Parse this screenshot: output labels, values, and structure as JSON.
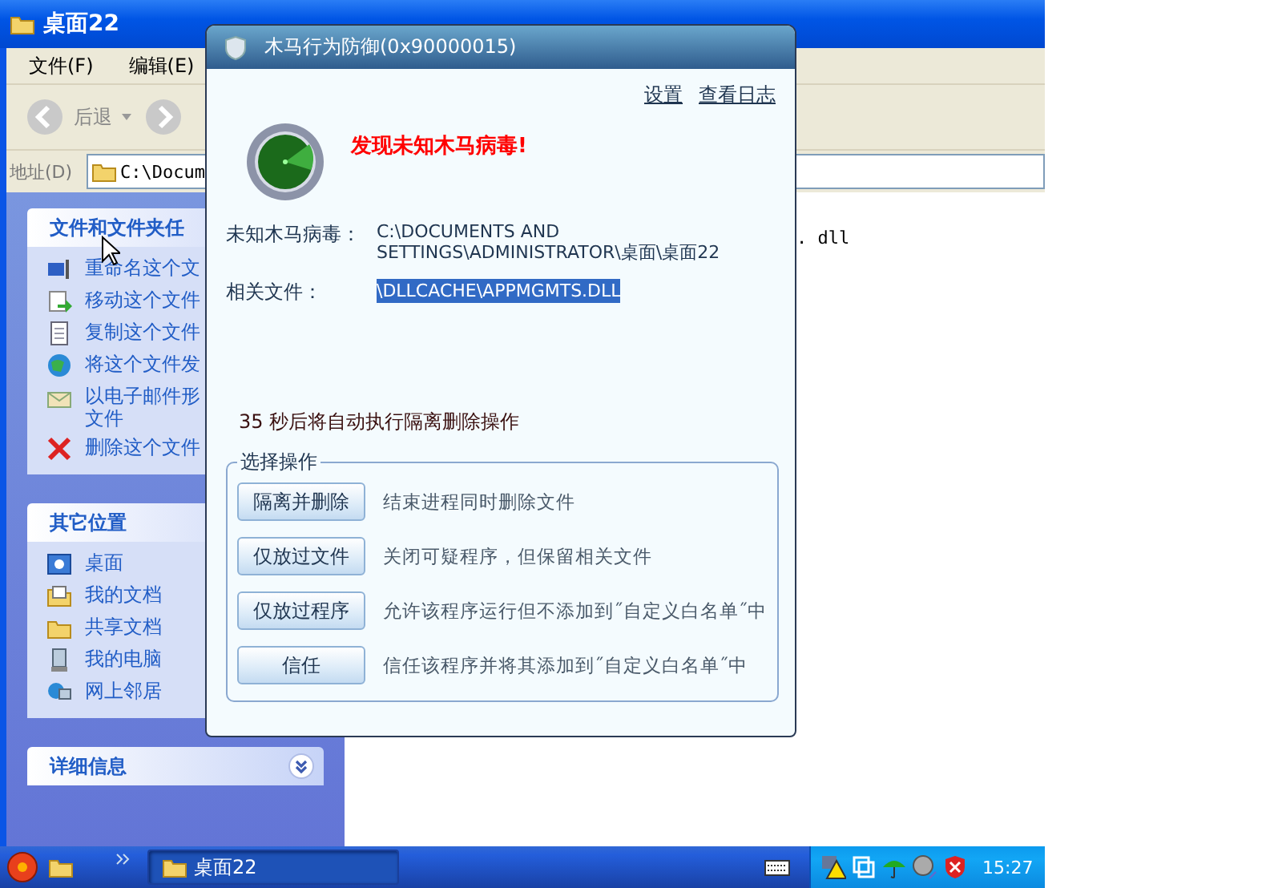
{
  "explorer": {
    "title": "桌面22",
    "menu": [
      "文件(F)",
      "编辑(E)"
    ],
    "back": "后退",
    "address": {
      "label": "地址(D)",
      "value": "C:\\Docum"
    },
    "file_fragment": ". dll",
    "task_panel": {
      "title": "文件和文件夹任",
      "items": [
        {
          "label": "重命名这个文"
        },
        {
          "label": "移动这个文件"
        },
        {
          "label": "复制这个文件"
        },
        {
          "label": "将这个文件发"
        },
        {
          "label": "以电子邮件形文件"
        },
        {
          "label": "删除这个文件"
        }
      ]
    },
    "other_places": {
      "title": "其它位置",
      "items": [
        {
          "label": "桌面"
        },
        {
          "label": "我的文档"
        },
        {
          "label": "共享文档"
        },
        {
          "label": "我的电脑"
        },
        {
          "label": "网上邻居"
        }
      ]
    },
    "details": {
      "title": "详细信息"
    }
  },
  "dialog": {
    "title": "木马行为防御(0x90000015)",
    "links": [
      "设置",
      "查看日志"
    ],
    "alert": "发现未知木马病毒!",
    "fields": [
      {
        "label": "未知木马病毒：",
        "value": "C:\\DOCUMENTS AND SETTINGS\\ADMINISTRATOR\\桌面\\桌面22",
        "selected": false
      },
      {
        "label": "相关文件：",
        "value": "\\DLLCACHE\\APPMGMTS.DLL",
        "selected": true
      }
    ],
    "countdown": "35 秒后将自动执行隔离删除操作",
    "group": {
      "title": "选择操作",
      "actions": [
        {
          "button": "隔离并删除",
          "description": "结束进程同时删除文件"
        },
        {
          "button": "仅放过文件",
          "description": "关闭可疑程序，但保留相关文件"
        },
        {
          "button": "仅放过程序",
          "description": "允许该程序运行但不添加到˝自定义白名单˝中"
        },
        {
          "button": "信任",
          "description": "信任该程序并将其添加到˝自定义白名单˝中"
        }
      ]
    }
  },
  "taskbar": {
    "tasks": [
      {
        "label": "桌面22",
        "selected": true
      }
    ],
    "clock": "15:27"
  }
}
